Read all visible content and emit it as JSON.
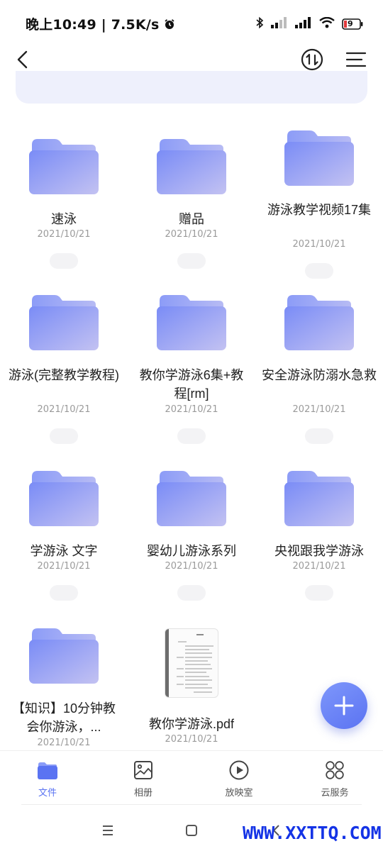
{
  "status_bar": {
    "time": "晚上10:49",
    "speed": "7.5K/s",
    "battery": "9",
    "icons": [
      "alarm-icon",
      "bluetooth-icon",
      "signal-icon",
      "signal-icon",
      "wifi-icon",
      "battery-icon"
    ]
  },
  "app_bar": {
    "icons": [
      "back-arrow-icon",
      "sort-icon",
      "menu-icon"
    ]
  },
  "files": [
    {
      "name": "速泳",
      "date": "2021/10/21",
      "type": "folder"
    },
    {
      "name": "赠品",
      "date": "2021/10/21",
      "type": "folder"
    },
    {
      "name": "游泳教学视频17集",
      "date": "2021/10/21",
      "type": "folder"
    },
    {
      "name": "游泳(完整教学教程)",
      "date": "2021/10/21",
      "type": "folder"
    },
    {
      "name": "教你学游泳6集+教程[rm]",
      "date": "2021/10/21",
      "type": "folder"
    },
    {
      "name": "安全游泳防溺水急救",
      "date": "2021/10/21",
      "type": "folder"
    },
    {
      "name": "学游泳 文字",
      "date": "2021/10/21",
      "type": "folder"
    },
    {
      "name": "婴幼儿游泳系列",
      "date": "2021/10/21",
      "type": "folder"
    },
    {
      "name": "央视跟我学游泳",
      "date": "2021/10/21",
      "type": "folder"
    },
    {
      "name": "【知识】10分钟教会你游泳，...",
      "date": "2021/10/21",
      "type": "folder"
    },
    {
      "name": "教你学游泳.pdf",
      "date": "2021/10/21",
      "type": "pdf"
    }
  ],
  "fab": {
    "icon": "plus-icon"
  },
  "bottom_nav": [
    {
      "label": "文件",
      "icon": "folder-icon",
      "active": true
    },
    {
      "label": "相册",
      "icon": "photo-icon",
      "active": false
    },
    {
      "label": "放映室",
      "icon": "play-icon",
      "active": false
    },
    {
      "label": "云服务",
      "icon": "grid-icon",
      "active": false
    }
  ],
  "system_nav": {
    "icons": [
      "recents-icon",
      "home-icon",
      "back-icon"
    ]
  },
  "watermark": "WWW.XXTTQ.COM",
  "colors": {
    "accent": "#5a73f2",
    "folder_light": "#c9c8f3",
    "folder_main": "#7f90f6",
    "strip": "#eef0fc"
  }
}
